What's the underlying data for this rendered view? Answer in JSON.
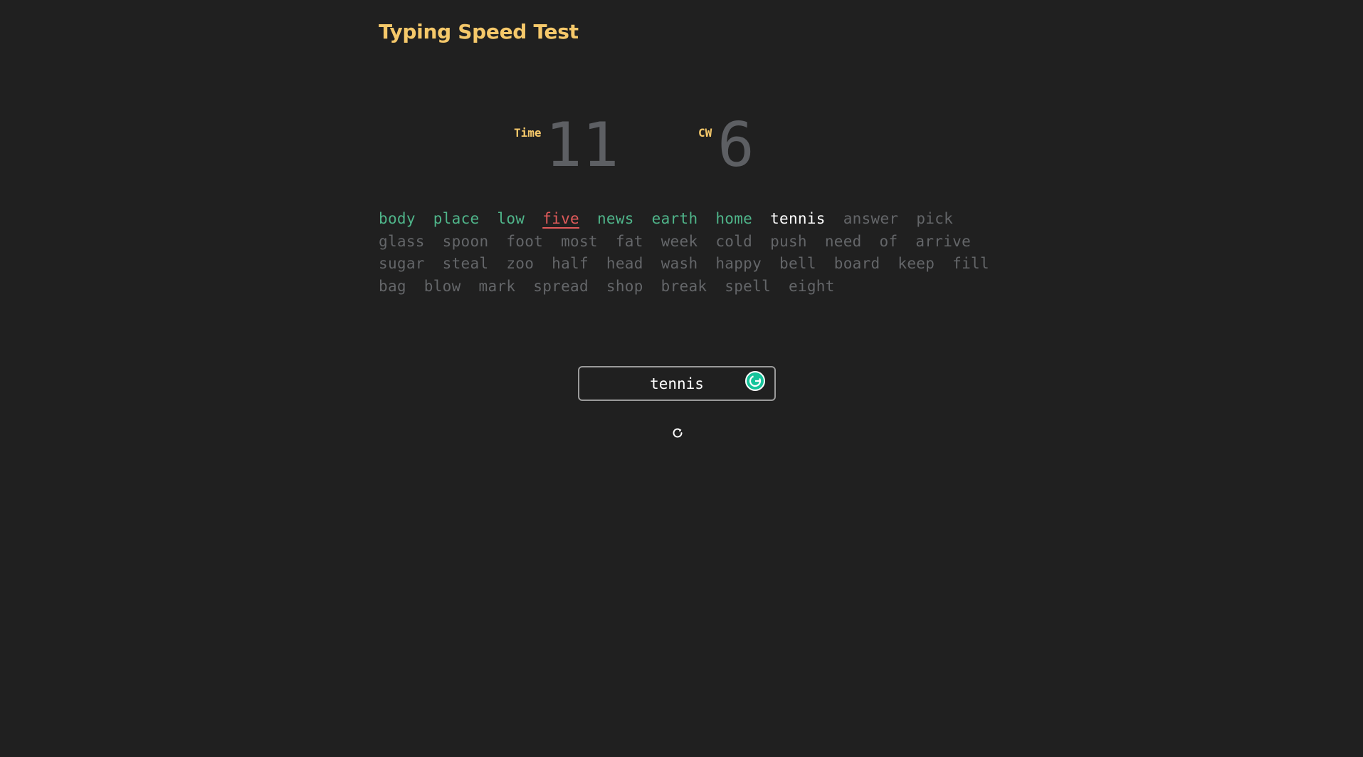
{
  "app": {
    "title": "Typing Speed Test"
  },
  "stats": {
    "time_label": "Time",
    "time_value": "11",
    "cw_label": "CW",
    "cw_value": "6"
  },
  "words": [
    {
      "text": "body",
      "state": "correct"
    },
    {
      "text": "place",
      "state": "correct"
    },
    {
      "text": "low",
      "state": "correct"
    },
    {
      "text": "five",
      "state": "incorrect"
    },
    {
      "text": "news",
      "state": "correct"
    },
    {
      "text": "earth",
      "state": "correct"
    },
    {
      "text": "home",
      "state": "correct"
    },
    {
      "text": "tennis",
      "state": "current"
    },
    {
      "text": "answer",
      "state": "pending"
    },
    {
      "text": "pick",
      "state": "pending"
    },
    {
      "text": "glass",
      "state": "pending"
    },
    {
      "text": "spoon",
      "state": "pending"
    },
    {
      "text": "foot",
      "state": "pending"
    },
    {
      "text": "most",
      "state": "pending"
    },
    {
      "text": "fat",
      "state": "pending"
    },
    {
      "text": "week",
      "state": "pending"
    },
    {
      "text": "cold",
      "state": "pending"
    },
    {
      "text": "push",
      "state": "pending"
    },
    {
      "text": "need",
      "state": "pending"
    },
    {
      "text": "of",
      "state": "pending"
    },
    {
      "text": "arrive",
      "state": "pending"
    },
    {
      "text": "sugar",
      "state": "pending"
    },
    {
      "text": "steal",
      "state": "pending"
    },
    {
      "text": "zoo",
      "state": "pending"
    },
    {
      "text": "half",
      "state": "pending"
    },
    {
      "text": "head",
      "state": "pending"
    },
    {
      "text": "wash",
      "state": "pending"
    },
    {
      "text": "happy",
      "state": "pending"
    },
    {
      "text": "bell",
      "state": "pending"
    },
    {
      "text": "board",
      "state": "pending"
    },
    {
      "text": "keep",
      "state": "pending"
    },
    {
      "text": "fill",
      "state": "pending"
    },
    {
      "text": "bag",
      "state": "pending"
    },
    {
      "text": "blow",
      "state": "pending"
    },
    {
      "text": "mark",
      "state": "pending"
    },
    {
      "text": "spread",
      "state": "pending"
    },
    {
      "text": "shop",
      "state": "pending"
    },
    {
      "text": "break",
      "state": "pending"
    },
    {
      "text": "spell",
      "state": "pending"
    },
    {
      "text": "eight",
      "state": "pending"
    }
  ],
  "input": {
    "value": "tennis"
  },
  "icons": {
    "restart": "restart-icon",
    "grammarly": "grammarly-icon"
  },
  "colors": {
    "background": "#202020",
    "accent": "#f5c86a",
    "correct": "#4fb58a",
    "incorrect": "#e05a5a",
    "current": "#ffffff",
    "pending": "#646669"
  }
}
